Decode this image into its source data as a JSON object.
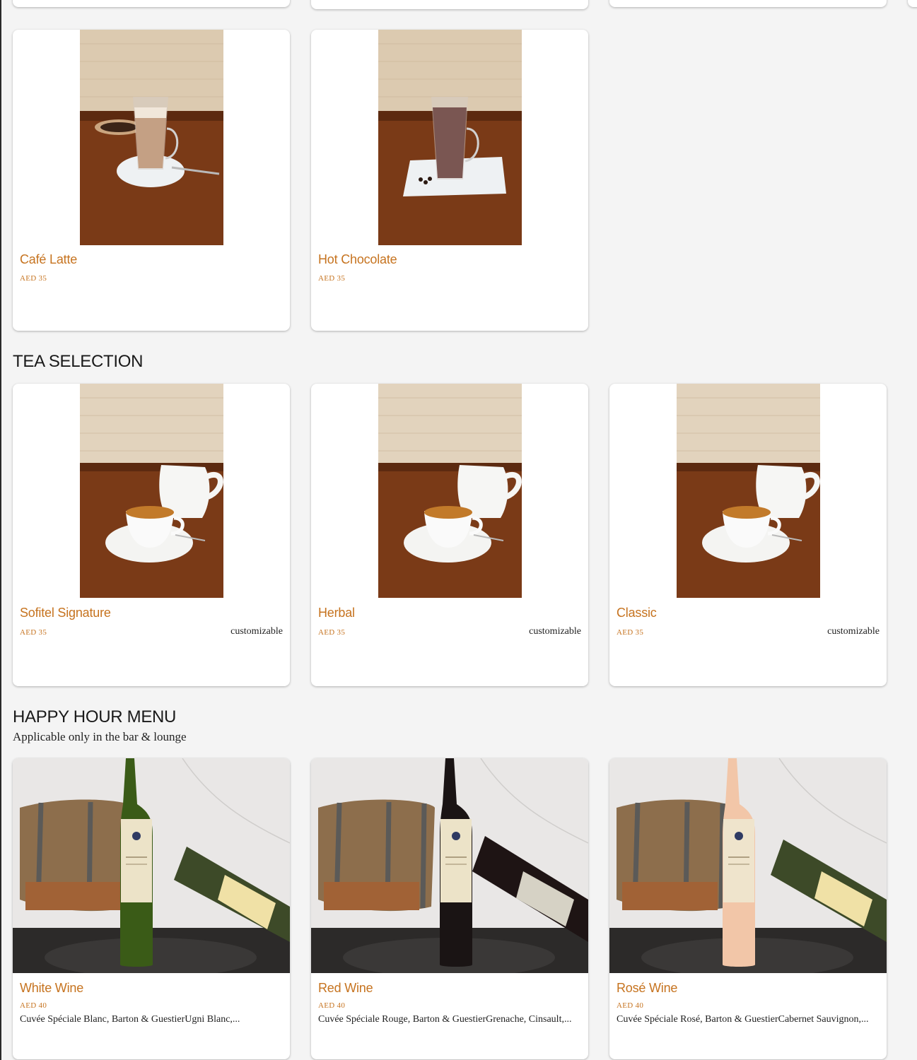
{
  "coffee_section": {
    "items": [
      {
        "name": "Café Latte",
        "price": "AED 35",
        "image": "latte-glass-photo"
      },
      {
        "name": "Hot Chocolate",
        "price": "AED 35",
        "image": "hot-chocolate-glass-photo"
      }
    ]
  },
  "tea_section": {
    "title": "TEA SELECTION",
    "items": [
      {
        "name": "Sofitel Signature",
        "price": "AED 35",
        "tag": "customizable",
        "image": "tea-cup-photo"
      },
      {
        "name": "Herbal",
        "price": "AED 35",
        "tag": "customizable",
        "image": "tea-cup-photo"
      },
      {
        "name": "Classic",
        "price": "AED 35",
        "tag": "customizable",
        "image": "tea-cup-photo"
      }
    ]
  },
  "happy_hour_section": {
    "title": "HAPPY HOUR MENU",
    "subtitle": "Applicable only in the bar & lounge",
    "items": [
      {
        "name": "White Wine",
        "price": "AED 40",
        "description": "Cuvée Spéciale Blanc, Barton & GuestierUgni Blanc,...",
        "image": "white-wine-bottle-photo"
      },
      {
        "name": "Red Wine",
        "price": "AED 40",
        "description": "Cuvée Spéciale Rouge, Barton & GuestierGrenache, Cinsault,...",
        "image": "red-wine-bottle-photo"
      },
      {
        "name": "Rosé Wine",
        "price": "AED 40",
        "description": "Cuvée Spéciale Rosé, Barton & GuestierCabernet Sauvignon,...",
        "image": "rose-wine-bottle-photo"
      }
    ]
  },
  "colors": {
    "accent": "#c6731f",
    "background": "#f4f4f4",
    "card": "#ffffff"
  }
}
